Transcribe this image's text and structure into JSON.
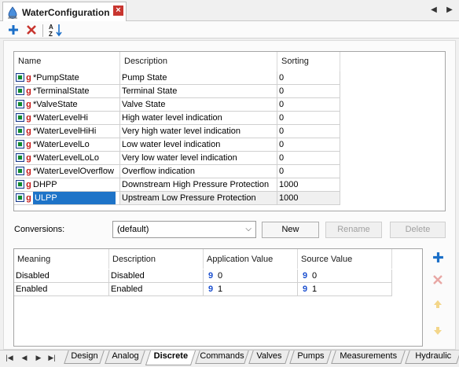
{
  "document": {
    "title": "WaterConfiguration",
    "close_label": "×"
  },
  "toolbar": {
    "add_icon": "plus-icon",
    "delete_icon": "x-icon",
    "sort_icon": "sort-az-icon"
  },
  "variables_grid": {
    "columns": [
      "Name",
      "Description",
      "Sorting"
    ],
    "rows": [
      {
        "name": "*PumpState",
        "description": "Pump State",
        "sorting": "0"
      },
      {
        "name": "*TerminalState",
        "description": "Terminal State",
        "sorting": "0"
      },
      {
        "name": "*ValveState",
        "description": "Valve State",
        "sorting": "0"
      },
      {
        "name": "*WaterLevelHi",
        "description": "High water level indication",
        "sorting": "0"
      },
      {
        "name": "*WaterLevelHiHi",
        "description": "Very high water level indication",
        "sorting": "0"
      },
      {
        "name": "*WaterLevelLo",
        "description": "Low water level indication",
        "sorting": "0"
      },
      {
        "name": "*WaterLevelLoLo",
        "description": "Very low water level indication",
        "sorting": "0"
      },
      {
        "name": "*WaterLevelOverflow",
        "description": "Overflow indication",
        "sorting": "0"
      },
      {
        "name": "DHPP",
        "description": "Downstream High Pressure Protection",
        "sorting": "1000"
      },
      {
        "name": "ULPP",
        "description": "Upstream Low Pressure Protection",
        "sorting": "1000",
        "selected": true
      }
    ],
    "row_icon_glyph": "g"
  },
  "conversions": {
    "label": "Conversions:",
    "selected": "(default)",
    "new_label": "New",
    "rename_label": "Rename",
    "delete_label": "Delete"
  },
  "conversion_grid": {
    "columns": [
      "Meaning",
      "Description",
      "Application Value",
      "Source Value"
    ],
    "rows": [
      {
        "meaning": "Disabled",
        "description": "Disabled",
        "app_value": "0",
        "source_value": "0"
      },
      {
        "meaning": "Enabled",
        "description": "Enabled",
        "app_value": "1",
        "source_value": "1"
      }
    ],
    "value_glyph": "9"
  },
  "bottom_tabs": [
    "Design",
    "Analog",
    "Discrete",
    "Commands",
    "Valves",
    "Pumps",
    "Measurements",
    "Hydraulic"
  ],
  "active_tab": "Discrete",
  "colors": {
    "selection": "#1e74c8",
    "accent_blue": "#1b6fc8",
    "delete_red": "#c8352f"
  }
}
